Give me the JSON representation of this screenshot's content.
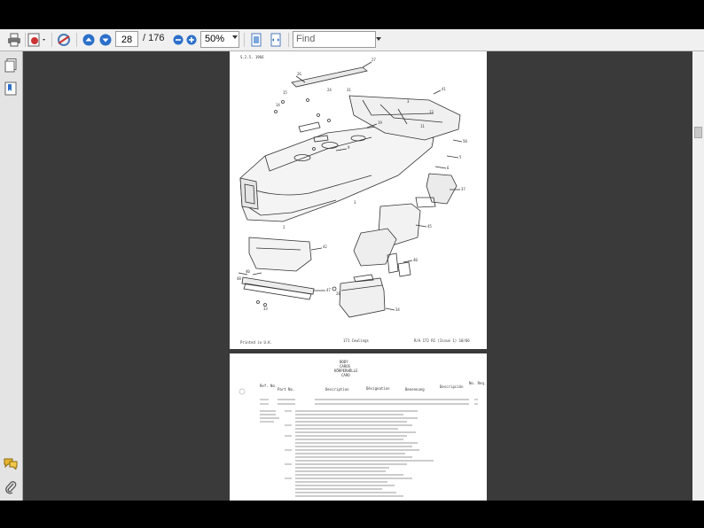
{
  "toolbar": {
    "page_current": "28",
    "page_total": "/ 176",
    "zoom": "50%",
    "find_placeholder": "Find"
  },
  "document": {
    "page1_header": "S.2.5. 1966",
    "page1_footer_left": "Printed in U.K.",
    "page1_footer_mid": "171 Cowlings",
    "page1_footer_right": "R/A 172 R1 (Issue 1) 10/66",
    "page2_header": [
      "BODY",
      "CAROS",
      "KÖRPERHÜLLE",
      "CARO"
    ],
    "page2_columns": [
      "Ref. No.",
      "Part No.",
      "Description",
      "Désignation",
      "Benennung",
      "Descripción",
      "No. Req."
    ]
  },
  "colors": {
    "viewer_bg": "#3a3a3a",
    "toolbar_bg": "#f0f0f0",
    "nav_arrow": "#2b6fc9"
  }
}
